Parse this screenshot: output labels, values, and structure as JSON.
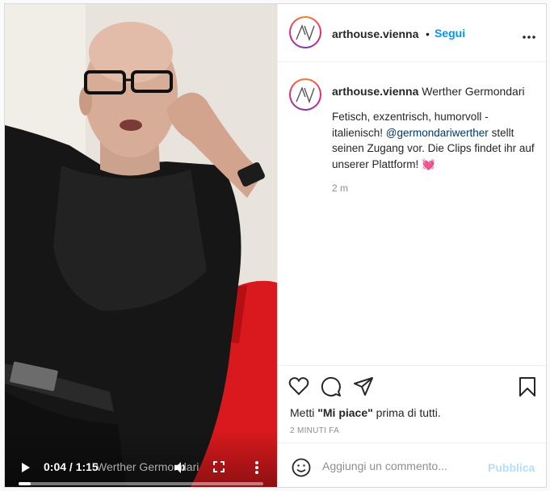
{
  "video": {
    "time": "0:04 / 1:15",
    "title": "Werther Germondari",
    "progress_fraction": 0.05
  },
  "account": {
    "username": "arthouse.vienna",
    "separator": "•",
    "follow_label": "Segui",
    "logo_text": "AV"
  },
  "caption": {
    "username": "arthouse.vienna",
    "title": "Werther Germondari",
    "text_before_mention": "Fetisch, exzentrisch, humorvoll - italienisch! ",
    "mention": "@germondariwerther",
    "text_after_mention": " stellt seinen Zugang vor. Die Clips findet ihr auf unserer Plattform! ",
    "emoji": "💓",
    "age": "2 m"
  },
  "engagement": {
    "likes_prefix": "Metti ",
    "likes_bold": "\"Mi piace\"",
    "likes_suffix": " prima di tutti.",
    "posted": "2 MINUTI FA"
  },
  "comment": {
    "placeholder": "Aggiungi un commento...",
    "publish_label": "Pubblica"
  },
  "colors": {
    "link_blue": "#0095f6",
    "mention_blue": "#00376b",
    "muted": "#8e8e8e",
    "publish_disabled": "#b2dffc"
  },
  "icons": [
    "play-icon",
    "volume-icon",
    "fullscreen-icon",
    "more-vertical-icon",
    "more-horizontal-icon",
    "heart-icon",
    "comment-icon",
    "share-icon",
    "bookmark-icon",
    "emoji-icon"
  ]
}
